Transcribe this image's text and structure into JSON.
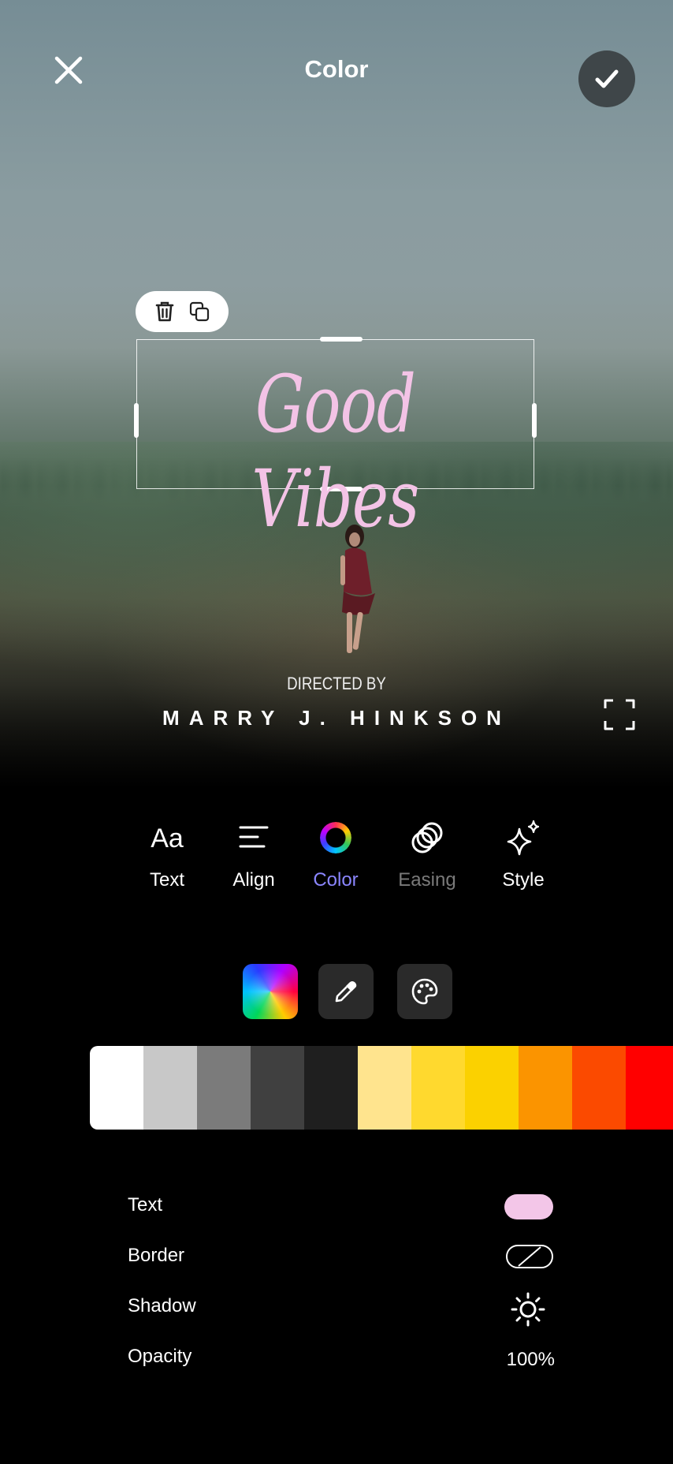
{
  "header": {
    "title": "Color",
    "close_icon": "close-icon",
    "confirm_icon": "check-icon"
  },
  "canvas": {
    "main_text": "Good Vibes",
    "main_text_color": "#f3c3e6",
    "credit_label": "DIRECTED BY",
    "credit_name": "MARRY J. HINKSON",
    "text_actions": [
      "trash-icon",
      "duplicate-icon"
    ],
    "fullscreen_icon": "fullscreen-icon"
  },
  "tabs": [
    {
      "label": "Text",
      "icon": "aa-text-icon",
      "state": "normal"
    },
    {
      "label": "Align",
      "icon": "align-left-icon",
      "state": "normal"
    },
    {
      "label": "Color",
      "icon": "color-wheel-icon",
      "state": "active"
    },
    {
      "label": "Easing",
      "icon": "easing-icon",
      "state": "disabled"
    },
    {
      "label": "Style",
      "icon": "sparkle-icon",
      "state": "normal"
    }
  ],
  "color_tools": [
    "spectrum-picker",
    "eyedropper-icon",
    "palette-icon"
  ],
  "palette": [
    "#ffffff",
    "#c8c8c8",
    "#7b7b7b",
    "#404040",
    "#1f1f1f",
    "#ffe48e",
    "#ffd92e",
    "#fbd100",
    "#fb9400",
    "#fb4a00",
    "#ff0000"
  ],
  "properties": {
    "text_label": "Text",
    "text_color": "#f3c6e8",
    "border_label": "Border",
    "shadow_label": "Shadow",
    "opacity_label": "Opacity",
    "opacity_value": "100%"
  },
  "accent_color": "#8b86ff"
}
